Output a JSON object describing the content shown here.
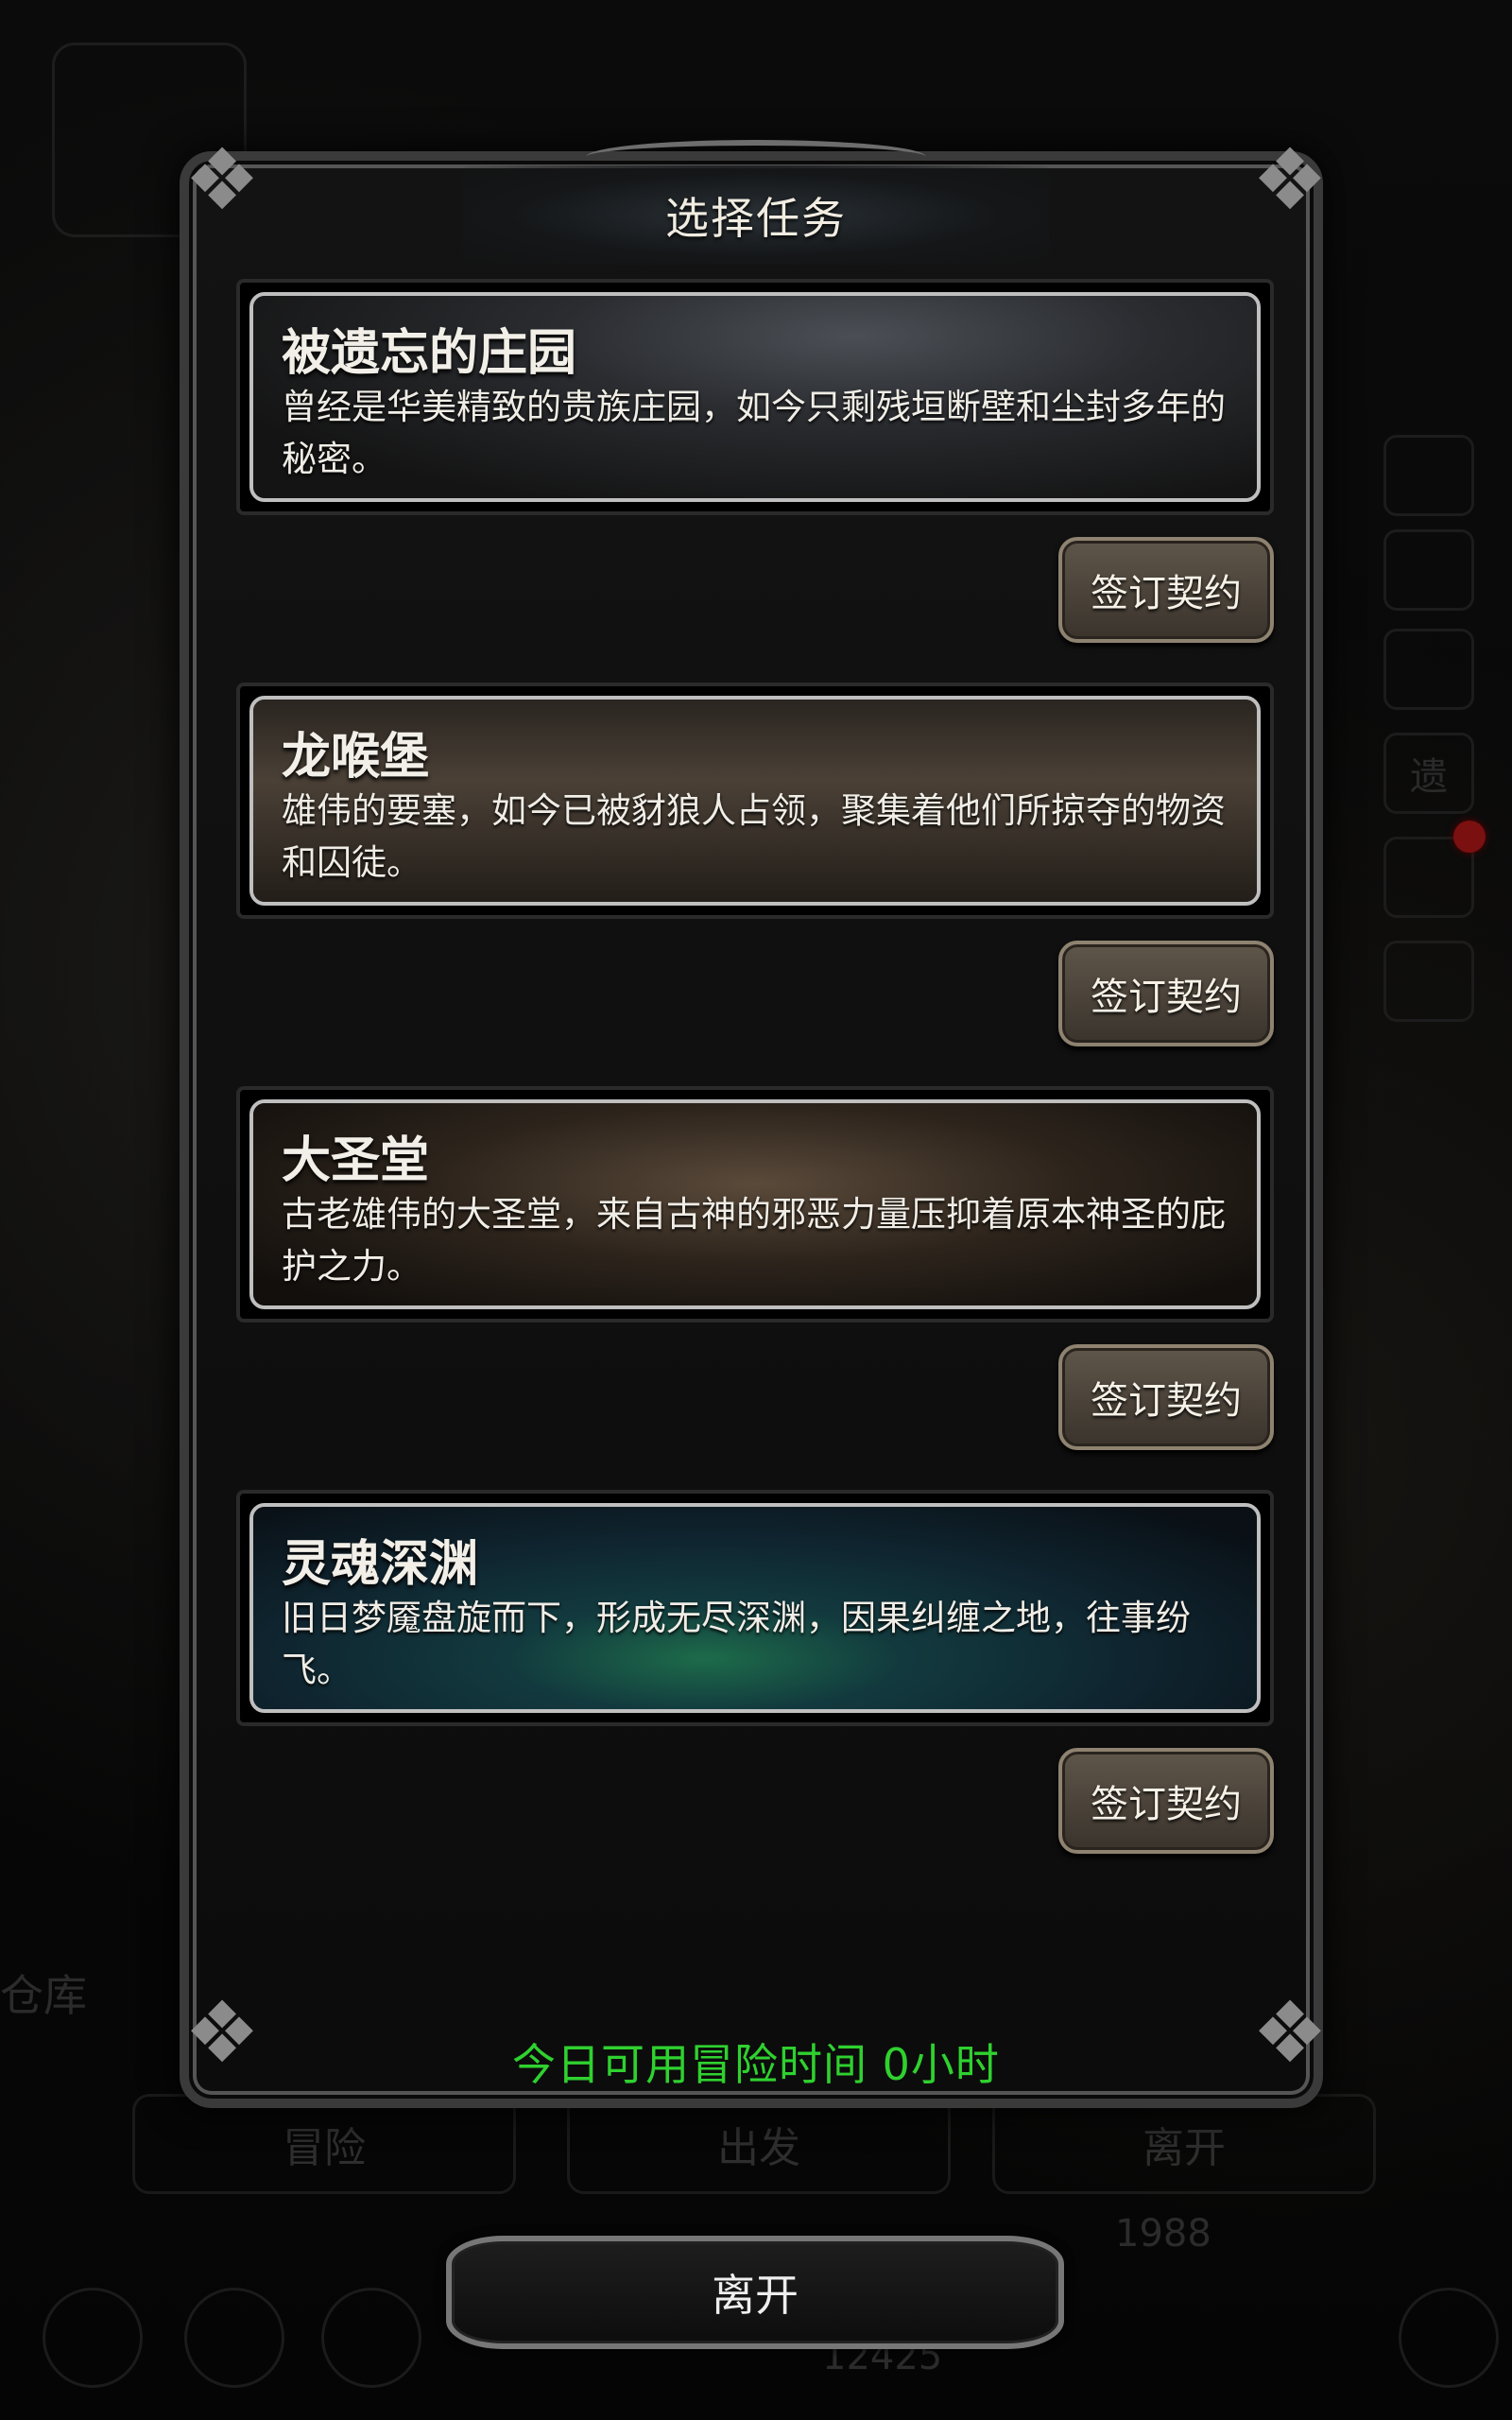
{
  "dialog": {
    "title": "选择任务",
    "missions": [
      {
        "name": "被遗忘的庄园",
        "description": "曾经是华美精致的贵族庄园，如今只剩残垣断壁和尘封多年的秘密。",
        "button": "签订契约"
      },
      {
        "name": "龙喉堡",
        "description": "雄伟的要塞，如今已被豺狼人占领，聚集着他们所掠夺的物资和囚徒。",
        "button": "签订契约"
      },
      {
        "name": "大圣堂",
        "description": "古老雄伟的大圣堂，来自古神的邪恶力量压抑着原本神圣的庇护之力。",
        "button": "签订契约"
      },
      {
        "name": "灵魂深渊",
        "description": "旧日梦魇盘旋而下，形成无尽深渊，因果纠缠之地，往事纷飞。",
        "button": "签订契约"
      }
    ],
    "time_info": "今日可用冒险时间 0小时"
  },
  "leave_button": "离开",
  "background": {
    "left_label": "仓库",
    "side_label": "遗",
    "bottom_buttons": [
      "冒险",
      "出发",
      "离开"
    ],
    "side_number": "1988",
    "bottom_number": "12425"
  },
  "colors": {
    "time_info": "#2fd12f",
    "accent_red": "#7a1010"
  }
}
